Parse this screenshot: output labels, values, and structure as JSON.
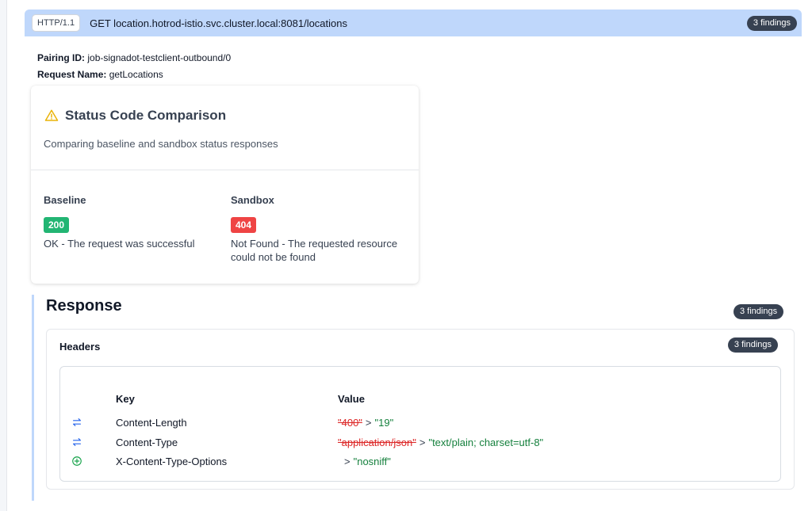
{
  "request": {
    "protocol": "HTTP/1.1",
    "line": "GET location.hotrod-istio.svc.cluster.local:8081/locations",
    "findings": "3 findings"
  },
  "meta": {
    "pairing_label": "Pairing ID:",
    "pairing_value": "job-signadot-testclient-outbound/0",
    "name_label": "Request Name:",
    "name_value": "getLocations"
  },
  "status_card": {
    "title": "Status Code Comparison",
    "subtitle": "Comparing baseline and sandbox status responses",
    "baseline": {
      "label": "Baseline",
      "code": "200",
      "desc": "OK - The request was successful"
    },
    "sandbox": {
      "label": "Sandbox",
      "code": "404",
      "desc": "Not Found - The requested resource could not be found"
    }
  },
  "response": {
    "title": "Response",
    "findings": "3 findings",
    "headers": {
      "title": "Headers",
      "findings": "3 findings",
      "col_key": "Key",
      "col_value": "Value",
      "rows": [
        {
          "icon": "swap-icon",
          "key": "Content-Length",
          "old": "\"400\"",
          "arrow": ">",
          "new": "\"19\""
        },
        {
          "icon": "swap-icon",
          "key": "Content-Type",
          "old": "\"application/json\"",
          "arrow": ">",
          "new": "\"text/plain; charset=utf-8\""
        },
        {
          "icon": "add-circle-icon",
          "key": "X-Content-Type-Options",
          "old": "",
          "arrow": ">",
          "new": "\"nosniff\""
        }
      ]
    }
  },
  "colors": {
    "header_bar": "#bfd7fb",
    "ok": "#22b573",
    "error": "#ef4444",
    "old_value": "#dc2626",
    "new_value": "#15803d",
    "swap_icon": "#2563eb",
    "add_icon": "#16a34a"
  }
}
